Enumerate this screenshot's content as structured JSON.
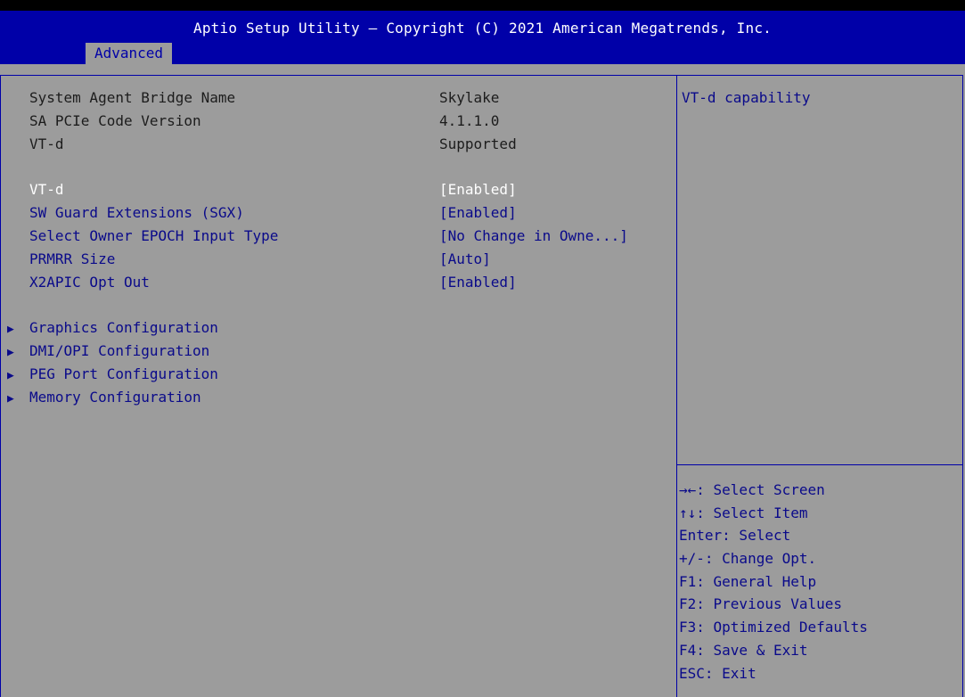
{
  "header": {
    "title": "Aptio Setup Utility – Copyright (C) 2021 American Megatrends, Inc.",
    "tab": "Advanced"
  },
  "info_items": [
    {
      "label": "System Agent Bridge Name",
      "value": "Skylake"
    },
    {
      "label": "SA PCIe Code Version",
      "value": "4.1.1.0"
    },
    {
      "label": "VT-d",
      "value": "Supported"
    }
  ],
  "options": [
    {
      "label": "VT-d",
      "value": "[Enabled]",
      "selected": true
    },
    {
      "label": "SW Guard Extensions (SGX)",
      "value": "[Enabled]"
    },
    {
      "label": "Select Owner EPOCH Input Type",
      "value": "[No Change in Owne...]"
    },
    {
      "label": "PRMRR Size",
      "value": "[Auto]"
    },
    {
      "label": "X2APIC Opt Out",
      "value": "[Enabled]"
    }
  ],
  "submenus": [
    {
      "label": "Graphics Configuration"
    },
    {
      "label": "DMI/OPI Configuration"
    },
    {
      "label": "PEG Port Configuration"
    },
    {
      "label": "Memory Configuration"
    }
  ],
  "submenu_icon": "▶",
  "help": {
    "text": "VT-d capability"
  },
  "keys": [
    "→←: Select Screen",
    "↑↓: Select Item",
    "Enter: Select",
    "+/-: Change Opt.",
    "F1: General Help",
    "F2: Previous Values",
    "F3: Optimized Defaults",
    "F4: Save & Exit",
    "ESC: Exit"
  ],
  "colors": {
    "header_bg": "#0000a8",
    "panel_bg": "#9c9c9c",
    "option_text": "#0a0a8a",
    "selected_text": "#ffffff"
  }
}
